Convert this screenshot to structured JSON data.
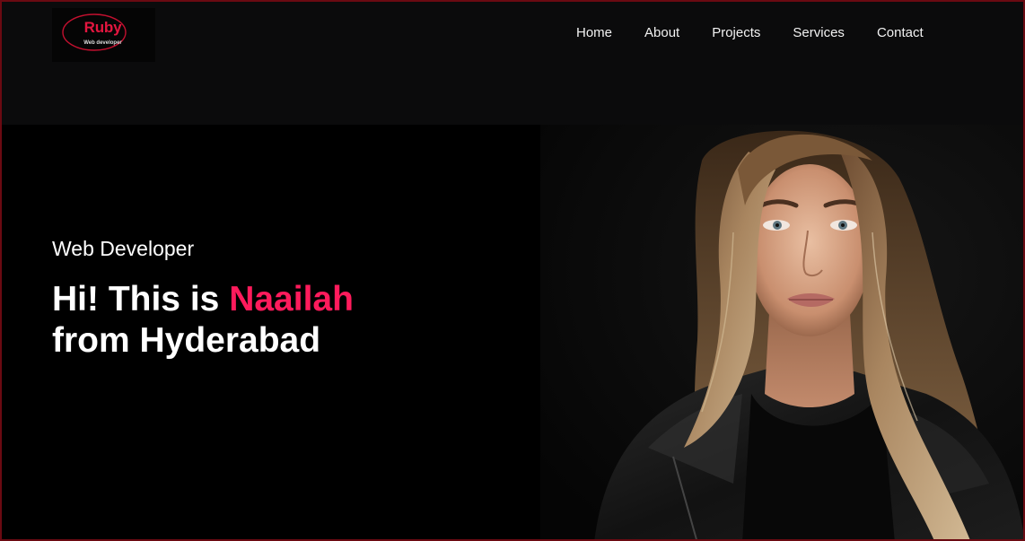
{
  "logo": {
    "name": "Ruby",
    "tagline": "Web developer"
  },
  "nav": {
    "items": [
      "Home",
      "About",
      "Projects",
      "Services",
      "Contact"
    ]
  },
  "hero": {
    "subtitle": "Web Developer",
    "greeting": "Hi! This is ",
    "name": "Naailah",
    "location_line": "from Hyderabad",
    "image": "portrait-photo"
  },
  "colors": {
    "accent": "#ff1b5c",
    "background": "#000000",
    "navbar": "#0b0b0c"
  }
}
